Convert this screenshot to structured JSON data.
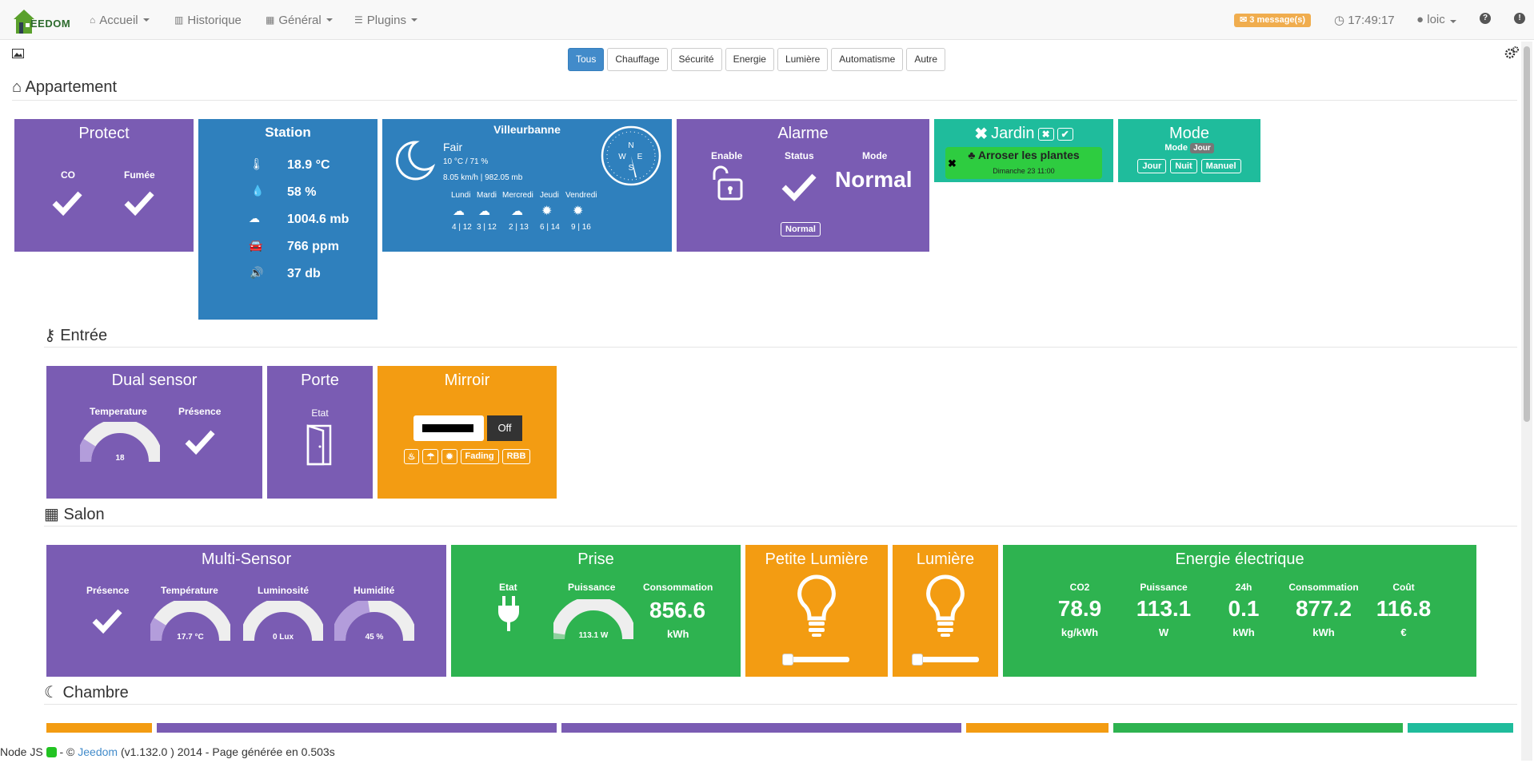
{
  "nav": {
    "logo_text": "EEDOM",
    "accueil": "Accueil",
    "historique": "Historique",
    "general": "Général",
    "plugins": "Plugins",
    "messages": "3 message(s)",
    "time": "17:49:17",
    "user": "loic"
  },
  "filters": [
    "Tous",
    "Chauffage",
    "Sécurité",
    "Energie",
    "Lumière",
    "Automatisme",
    "Autre"
  ],
  "sections": {
    "appartement": "Appartement",
    "entree": "Entrée",
    "salon": "Salon",
    "chambre": "Chambre"
  },
  "protect": {
    "title": "Protect",
    "co": "CO",
    "fumee": "Fumée"
  },
  "station": {
    "title": "Station",
    "temp": "18.9 °C",
    "hum": "58 %",
    "pressure": "1004.6 mb",
    "co2": "766 ppm",
    "noise": "37 db"
  },
  "meteo": {
    "city": "Villeurbanne",
    "condition": "Fair",
    "line1": "10 °C / 71 %",
    "line2": "8.05 km/h | 982.05 mb",
    "days": [
      "Lundi",
      "Mardi",
      "Mercredi",
      "Jeudi",
      "Vendredi"
    ],
    "temps": [
      "4 | 12",
      "3 | 12",
      "2 | 13",
      "6 | 14",
      "9 | 16"
    ],
    "compass": {
      "n": "N",
      "s": "S",
      "e": "E",
      "w": "W"
    }
  },
  "alarme": {
    "title": "Alarme",
    "enable": "Enable",
    "status": "Status",
    "mode": "Mode",
    "mode_value": "Normal",
    "btn": "Normal"
  },
  "jardin": {
    "title": "Jardin",
    "task": "Arroser les plantes",
    "date": "Dimanche 23 11:00"
  },
  "mode": {
    "title": "Mode",
    "label": "Mode",
    "current": "Jour",
    "btns": [
      "Jour",
      "Nuit",
      "Manuel"
    ]
  },
  "dual": {
    "title": "Dual sensor",
    "temp_label": "Temperature",
    "pres_label": "Présence",
    "temp_value": "18",
    "temp_fraction": 0.18
  },
  "porte": {
    "title": "Porte",
    "etat": "Etat"
  },
  "mirroir": {
    "title": "Mirroir",
    "off": "Off",
    "btn_fading": "Fading",
    "btn_rbb": "RBB"
  },
  "multi": {
    "title": "Multi-Sensor",
    "presence": "Présence",
    "temperature": "Température",
    "luminosite": "Luminosité",
    "humidite": "Humidité",
    "temp_value": "17.7 °C",
    "lux_value": "0 Lux",
    "hum_value": "45 %",
    "temp_fraction": 0.18,
    "lux_fraction": 0.0,
    "hum_fraction": 0.45
  },
  "prise": {
    "title": "Prise",
    "etat": "Etat",
    "puissance": "Puissance",
    "consommation": "Consommation",
    "power_value": "113.1 W",
    "power_fraction": 0.05,
    "conso_value": "856.6",
    "conso_unit": "kWh"
  },
  "petite": {
    "title": "Petite Lumière"
  },
  "lumiere": {
    "title": "Lumière"
  },
  "energie": {
    "title": "Energie électrique",
    "cols": [
      {
        "label": "CO2",
        "value": "78.9",
        "unit": "kg/kWh"
      },
      {
        "label": "Puissance",
        "value": "113.1",
        "unit": "W"
      },
      {
        "label": "24h",
        "value": "0.1",
        "unit": "kWh"
      },
      {
        "label": "Consommation",
        "value": "877.2",
        "unit": "kWh"
      },
      {
        "label": "Coût",
        "value": "116.8",
        "unit": "€"
      }
    ]
  },
  "footer": {
    "node": "Node JS",
    "copy": "- ©",
    "brand": "Jeedom",
    "rest": "(v1.132.0 ) 2014 - Page générée en 0.503s"
  },
  "colors": {
    "purple": "#7a5cb3",
    "blue": "#2f80bd",
    "teal": "#1fbc9c",
    "orange": "#f39c12",
    "green": "#2eb350",
    "primary": "#428bca"
  }
}
